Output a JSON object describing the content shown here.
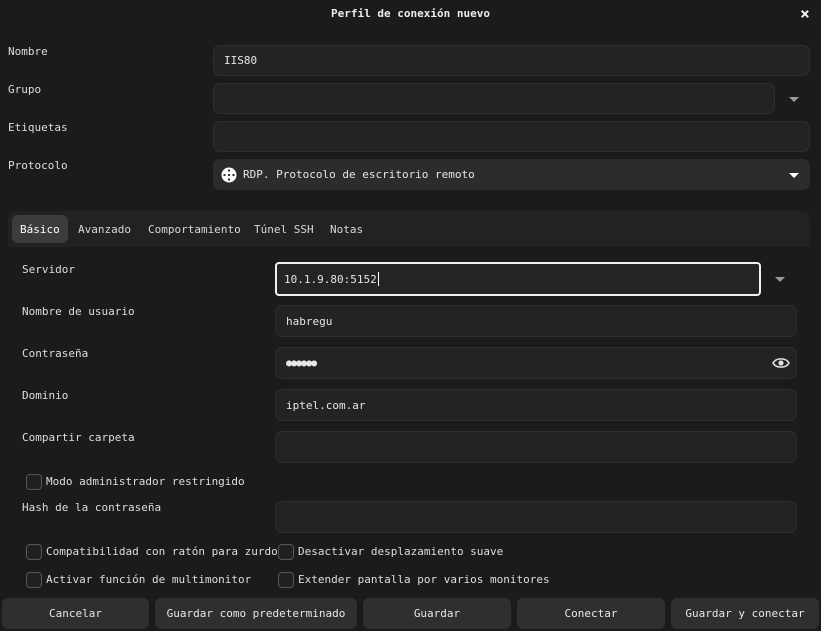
{
  "window": {
    "title": "Perfil de conexión nuevo",
    "close_icon": "×"
  },
  "form": {
    "nombre": {
      "label": "Nombre",
      "value": "IIS80"
    },
    "grupo": {
      "label": "Grupo",
      "value": ""
    },
    "etiquetas": {
      "label": "Etiquetas",
      "value": ""
    },
    "protocolo": {
      "label": "Protocolo",
      "value": "RDP. Protocolo de escritorio remoto",
      "icon": "rdp-icon"
    }
  },
  "tabs": [
    {
      "label": "Básico",
      "active": true
    },
    {
      "label": "Avanzado",
      "active": false
    },
    {
      "label": "Comportamiento",
      "active": false
    },
    {
      "label": "Túnel SSH",
      "active": false
    },
    {
      "label": "Notas",
      "active": false
    }
  ],
  "basic": {
    "servidor": {
      "label": "Servidor",
      "value": "10.1.9.80:5152"
    },
    "usuario": {
      "label": "Nombre de usuario",
      "value": "habregu"
    },
    "contrasena": {
      "label": "Contraseña",
      "value": "●●●●●●",
      "toggle_icon": "eye-icon"
    },
    "dominio": {
      "label": "Dominio",
      "value": "iptel.com.ar"
    },
    "carpeta": {
      "label": "Compartir carpeta",
      "value": ""
    },
    "modo_admin": {
      "label": "Modo administrador restringido",
      "checked": false
    },
    "hash": {
      "label": "Hash de la contraseña",
      "value": ""
    },
    "zurdos": {
      "label": "Compatibilidad con ratón para zurdos",
      "checked": false
    },
    "desplazamiento": {
      "label": "Desactivar desplazamiento suave",
      "checked": false
    },
    "multimonitor": {
      "label": "Activar función de multimonitor",
      "checked": false
    },
    "extender": {
      "label": "Extender pantalla por varios monitores",
      "checked": false
    }
  },
  "buttons": {
    "cancel": "Cancelar",
    "save_default": "Guardar como predeterminado",
    "save": "Guardar",
    "connect": "Conectar",
    "save_connect": "Guardar y conectar"
  },
  "colors": {
    "background": "#1b1b1b",
    "field": "#232323",
    "button": "#2f2f2f",
    "active_tab": "#3c3c3c"
  }
}
